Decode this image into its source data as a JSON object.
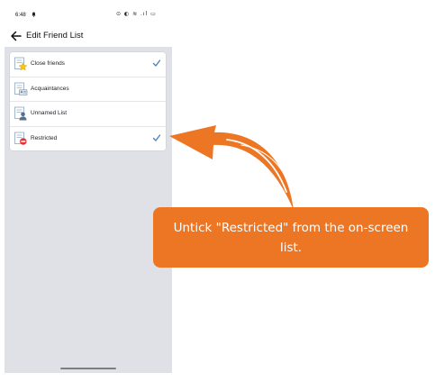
{
  "status_bar": {
    "time": "6:48",
    "icons": "⊙ ◐ ≋ .ıl ▭"
  },
  "header": {
    "title": "Edit Friend List"
  },
  "lists": [
    {
      "label": "Close friends",
      "icon": "star-list-icon",
      "checked": true
    },
    {
      "label": "Acquaintances",
      "icon": "acquaintances-list-icon",
      "checked": false
    },
    {
      "label": "Unnamed List",
      "icon": "person-list-icon",
      "checked": false
    },
    {
      "label": "Restricted",
      "icon": "restricted-list-icon",
      "checked": true
    }
  ],
  "annotation": {
    "text": "Untick \"Restricted\" from the on-screen list."
  },
  "colors": {
    "accent_orange": "#ec7623",
    "checkmark_blue": "#4a7fb5",
    "content_bg": "#dfe1e6"
  }
}
